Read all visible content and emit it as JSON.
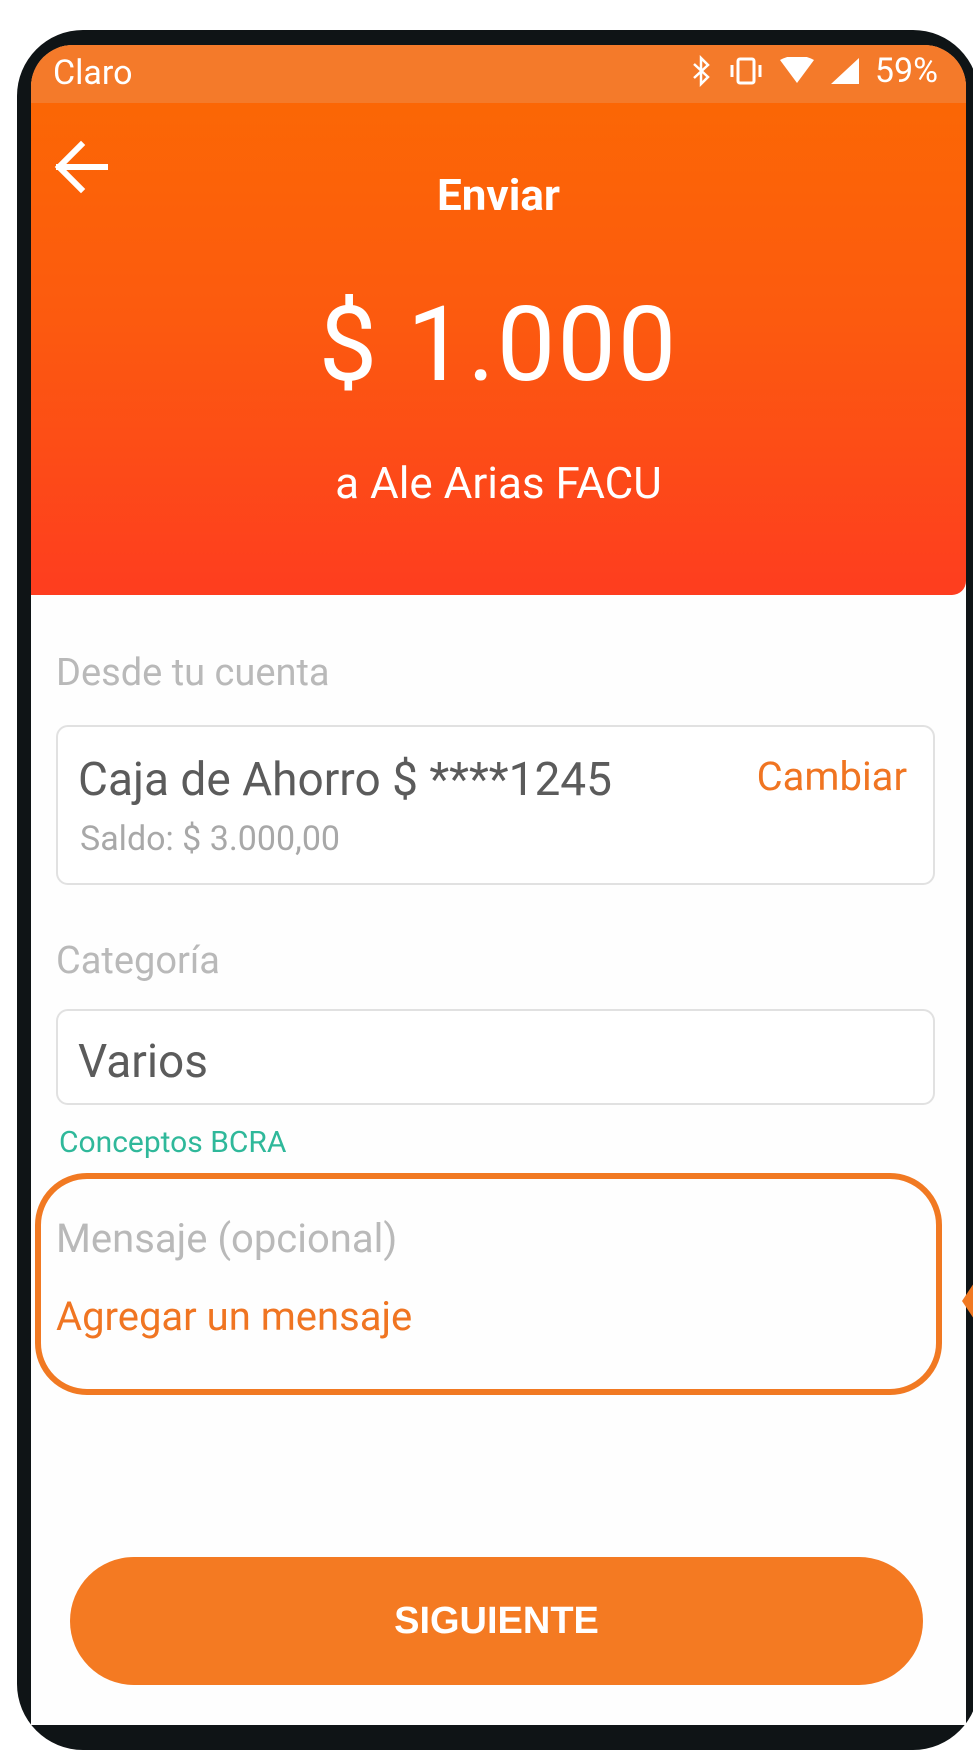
{
  "status_bar": {
    "carrier": "Claro",
    "battery": "59%"
  },
  "header": {
    "title": "Enviar",
    "amount": "$ 1.000",
    "recipient": "a Ale Arias FACU"
  },
  "account_section": {
    "label": "Desde tu cuenta",
    "account_name": "Caja de Ahorro $ ****1245",
    "balance": "Saldo: $ 3.000,00",
    "change_label": "Cambiar"
  },
  "category_section": {
    "label": "Categoría",
    "value": "Varios",
    "bcra_link": "Conceptos BCRA"
  },
  "message_section": {
    "label": "Mensaje (opcional)",
    "add_label": "Agregar un mensaje"
  },
  "next_button": {
    "label": "SIGUIENTE"
  },
  "colors": {
    "brand_orange": "#f47a22",
    "header_top": "#fb6a02",
    "header_bottom": "#fe3d1f",
    "link_green": "#2fb89a"
  }
}
